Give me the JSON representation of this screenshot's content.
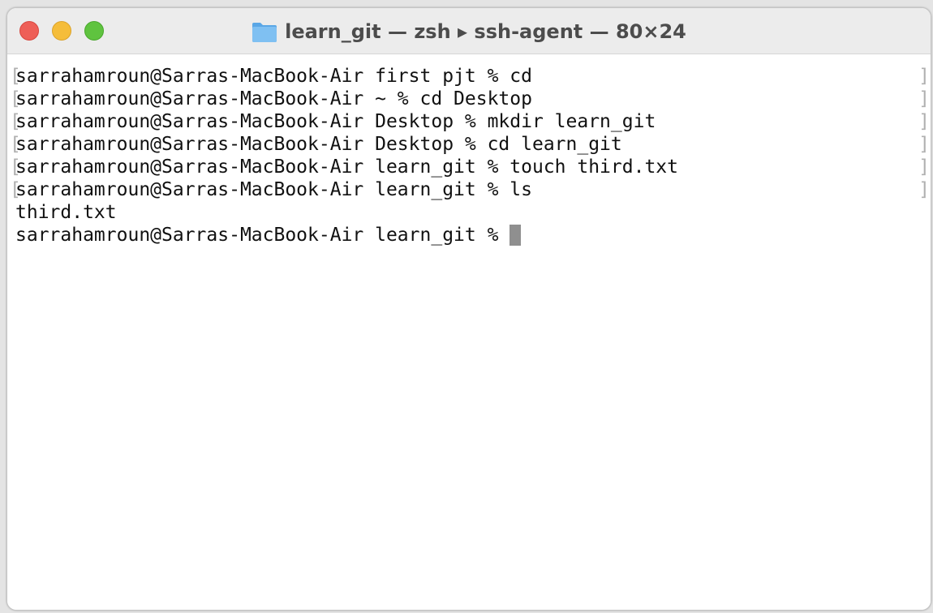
{
  "window": {
    "title": "learn_git — zsh ▸ ssh-agent — 80×24",
    "folder_icon": "folder-icon"
  },
  "terminal": {
    "lines": [
      "sarrahamroun@Sarras-MacBook-Air first pjt % cd",
      "sarrahamroun@Sarras-MacBook-Air ~ % cd Desktop",
      "sarrahamroun@Sarras-MacBook-Air Desktop % mkdir learn_git",
      "sarrahamroun@Sarras-MacBook-Air Desktop % cd learn_git",
      "sarrahamroun@Sarras-MacBook-Air learn_git % touch third.txt",
      "sarrahamroun@Sarras-MacBook-Air learn_git % ls",
      "third.txt"
    ],
    "prompt": "sarrahamroun@Sarras-MacBook-Air learn_git % ",
    "line_mark_left": "[",
    "line_mark_right": "]"
  },
  "colors": {
    "close": "#ee5f57",
    "minimize": "#f5bd3a",
    "zoom": "#5fc33f",
    "cursor": "#8f8f8f"
  }
}
